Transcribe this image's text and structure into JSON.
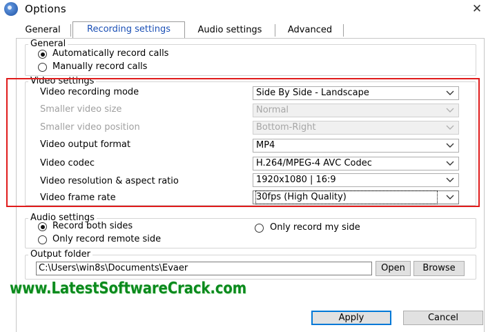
{
  "window": {
    "title": "Options",
    "close_symbol": "✕"
  },
  "tabs": [
    {
      "label": "General"
    },
    {
      "label": "Recording settings",
      "active": true
    },
    {
      "label": "Audio settings"
    },
    {
      "label": "Advanced"
    }
  ],
  "general": {
    "title": "General",
    "auto_record": "Automatically record calls",
    "manual_record": "Manually record calls",
    "selected": "auto_record"
  },
  "video": {
    "title": "Video settings",
    "rows": [
      {
        "label": "Video recording mode",
        "value": "Side By Side - Landscape",
        "enabled": true
      },
      {
        "label": "Smaller video size",
        "value": "Normal",
        "enabled": false
      },
      {
        "label": "Smaller video position",
        "value": "Bottom-Right",
        "enabled": false
      },
      {
        "label": "Video output format",
        "value": "MP4",
        "enabled": true
      },
      {
        "label": "Video codec",
        "value": "H.264/MPEG-4 AVC Codec",
        "enabled": true
      },
      {
        "label": "Video resolution & aspect ratio",
        "value": "1920x1080 | 16:9",
        "enabled": true
      },
      {
        "label": "Video frame rate",
        "value": "30fps (High Quality)",
        "enabled": true,
        "focused": true
      }
    ],
    "highlight_color": "#e01a1a"
  },
  "audio": {
    "title": "Audio settings",
    "both_sides": "Record both sides",
    "only_mine": "Only record my side",
    "only_remote": "Only record remote side",
    "selected": "both_sides"
  },
  "output": {
    "title": "Output folder",
    "path": "C:\\Users\\win8s\\Documents\\Evaer",
    "open_label": "Open",
    "browse_label": "Browse"
  },
  "footer": {
    "apply_label": "Apply",
    "cancel_label": "Cancel"
  },
  "watermark": "www.LatestSoftwareCrack.com",
  "colors": {
    "accent": "#0078d7",
    "tab_active_text": "#1a4fb5",
    "watermark": "#0b8a1d"
  }
}
